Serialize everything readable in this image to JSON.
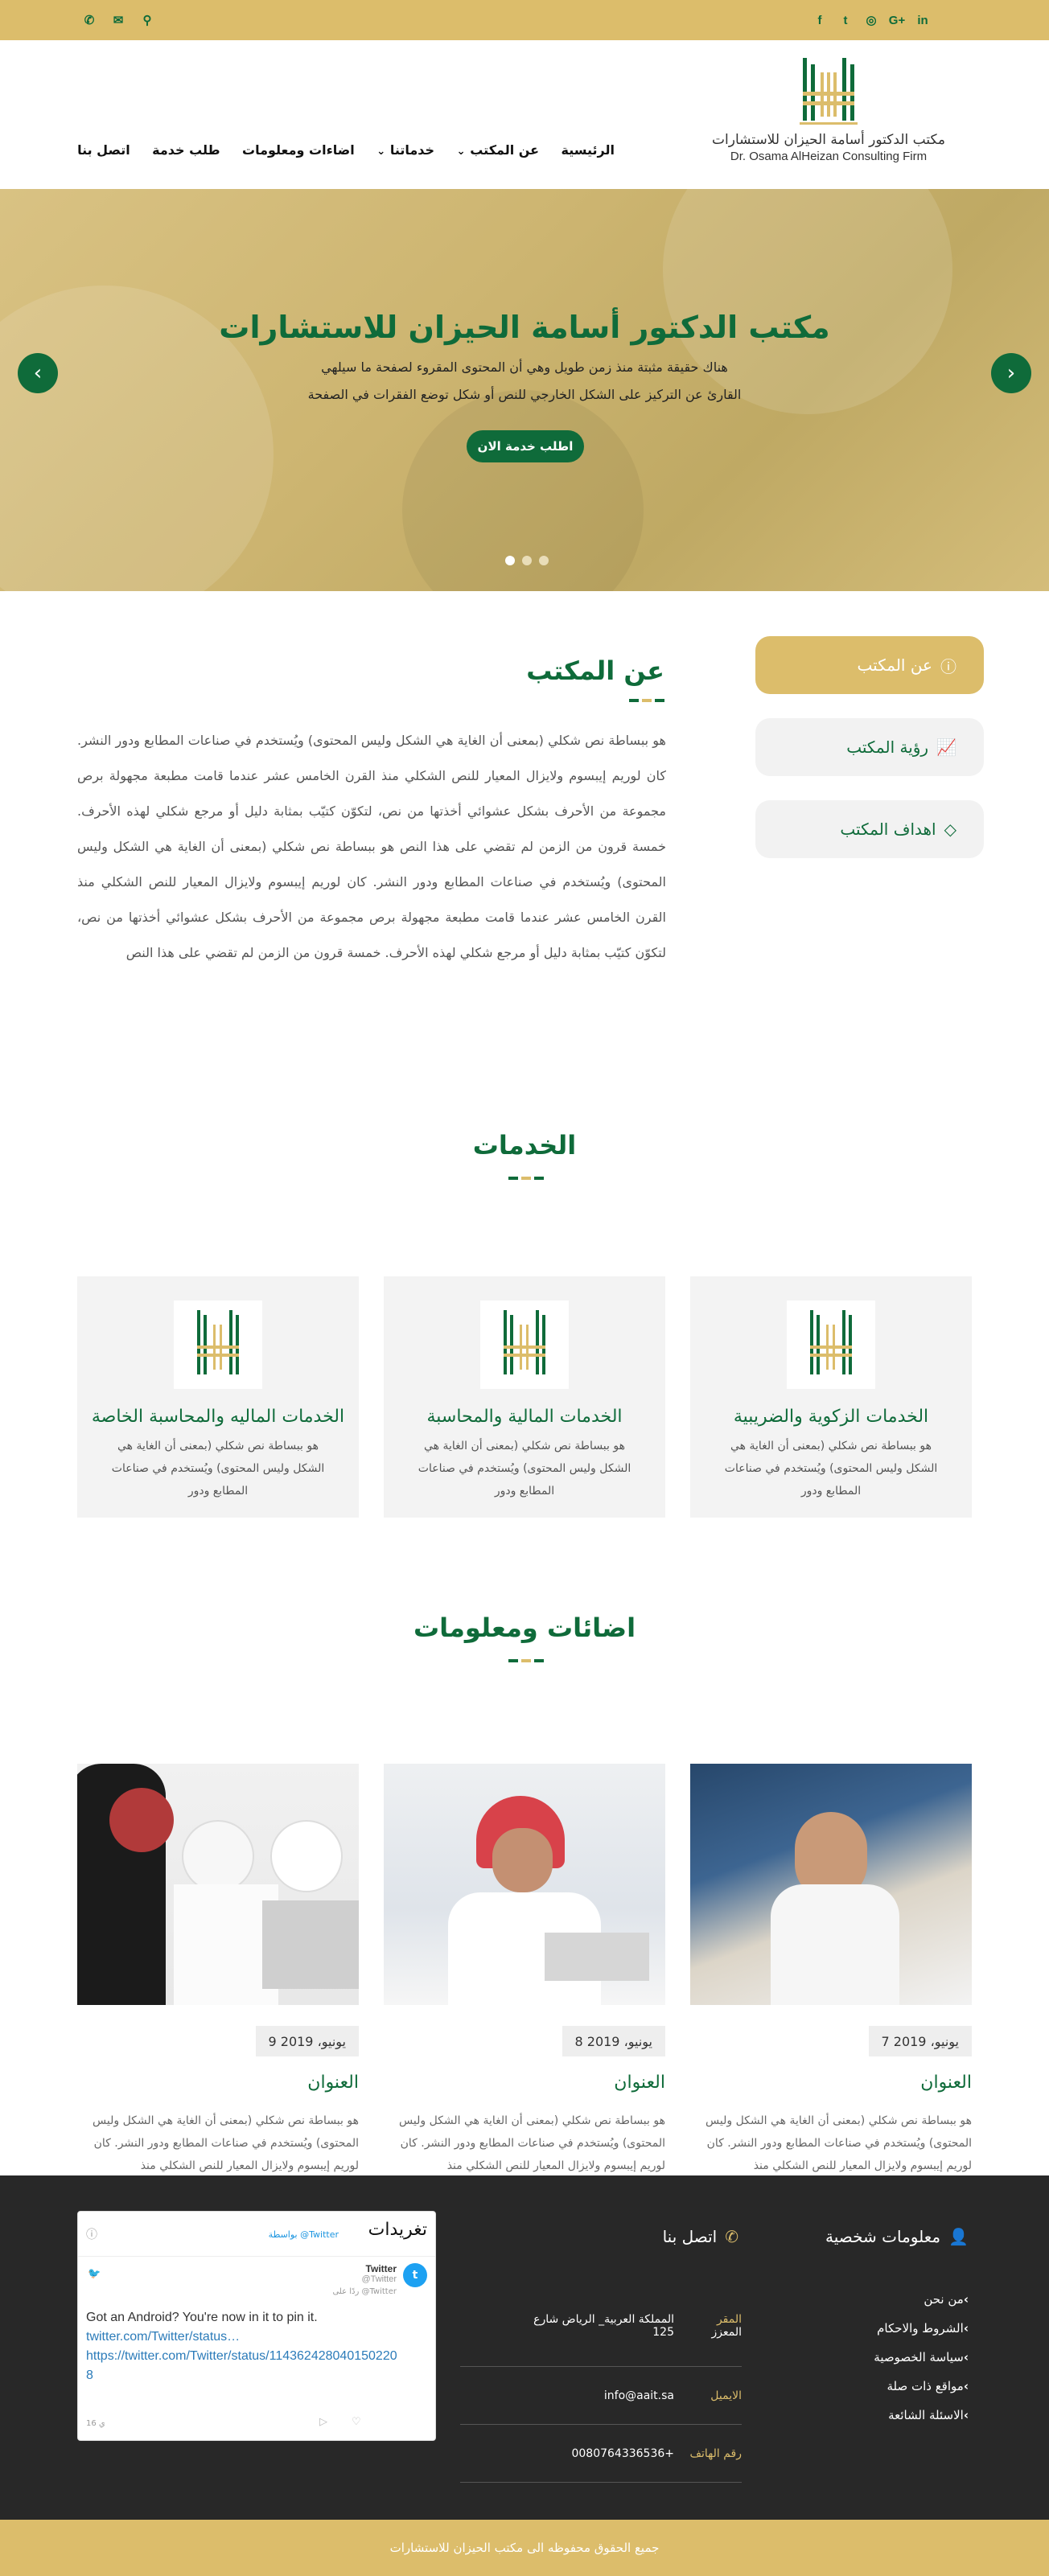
{
  "topbar": {
    "social_icons": [
      "facebook-icon",
      "twitter-icon",
      "instagram-icon",
      "google-plus-icon",
      "linkedin-icon"
    ],
    "social_glyphs": [
      "f",
      "t",
      "◎",
      "G+",
      "in"
    ],
    "tool_icons": [
      "phone-icon",
      "envelope-icon",
      "search-icon"
    ],
    "tool_glyphs": [
      "✆",
      "✉",
      "⚲"
    ]
  },
  "logo": {
    "line1": "مكتب الدكتور أسامة الحيزان للاستشارات",
    "line2": "Dr. Osama AlHeizan Consulting Firm"
  },
  "nav": {
    "items": [
      "الرئيسية",
      "عن المكتب",
      "خدماتنا",
      "اضاءات ومعلومات",
      "طلب خدمة",
      "اتصل بنا"
    ]
  },
  "hero": {
    "title": "مكتب الدكتور أسامة الحيزان للاستشارات",
    "line1": "هناك حقيقة مثبتة منذ زمن طويل وهي أن المحتوى المقروء لصفحة ما سيلهي",
    "line2": "القارئ عن التركيز على الشكل الخارجي للنص أو شكل توضع الفقرات في الصفحة",
    "button": "اطلب خدمة الان",
    "prev": "‹",
    "next": "›"
  },
  "about": {
    "title": "عن المكتب",
    "text": "هو ببساطة نص شكلي (بمعنى أن الغاية هي الشكل وليس المحتوى) ويُستخدم في صناعات المطابع ودور النشر. كان لوريم إيبسوم ولايزال المعيار للنص الشكلي منذ القرن الخامس عشر عندما قامت مطبعة مجهولة برص مجموعة من الأحرف بشكل عشوائي أخذتها من نص، لتكوّن كتيّب بمثابة دليل أو مرجع شكلي لهذه الأحرف. خمسة قرون من الزمن لم تقضي على هذا النص هو ببساطة نص شكلي (بمعنى أن الغاية هي الشكل وليس المحتوى) ويُستخدم في صناعات المطابع ودور النشر. كان لوريم إيبسوم ولايزال المعيار للنص الشكلي منذ القرن الخامس عشر عندما قامت مطبعة مجهولة برص مجموعة من الأحرف بشكل عشوائي أخذتها من نص، لتكوّن كتيّب بمثابة دليل أو مرجع شكلي لهذه الأحرف. خمسة قرون من الزمن لم تقضي على هذا النص",
    "tabs": [
      "عن المكتب",
      "رؤية المكتب",
      "اهداف المكتب"
    ]
  },
  "services": {
    "title": "الخدمات",
    "cards": [
      {
        "title": "الخدمات الزكوية والضريبية",
        "text": "هو ببساطة نص شكلي (بمعنى أن الغاية هي الشكل وليس المحتوى) ويُستخدم في صناعات المطابع ودور"
      },
      {
        "title": "الخدمات المالية والمحاسبة",
        "text": "هو ببساطة نص شكلي (بمعنى أن الغاية هي الشكل وليس المحتوى) ويُستخدم في صناعات المطابع ودور"
      },
      {
        "title": "الخدمات الماليه والمحاسبة الخاصة",
        "text": "هو ببساطة نص شكلي (بمعنى أن الغاية هي الشكل وليس المحتوى) ويُستخدم في صناعات المطابع ودور"
      }
    ]
  },
  "news": {
    "title": "اضائات ومعلومات",
    "posts": [
      {
        "date": "7 يونيو، 2019",
        "title": "العنوان",
        "text": "هو ببساطة نص شكلي (بمعنى أن الغاية هي الشكل وليس المحتوى) ويُستخدم في صناعات المطابع ودور النشر. كان لوريم إيبسوم ولايزال المعيار للنص الشكلي منذ"
      },
      {
        "date": "8 يونيو، 2019",
        "title": "العنوان",
        "text": "هو ببساطة نص شكلي (بمعنى أن الغاية هي الشكل وليس المحتوى) ويُستخدم في صناعات المطابع ودور النشر. كان لوريم إيبسوم ولايزال المعيار للنص الشكلي منذ"
      },
      {
        "date": "9 يونيو، 2019",
        "title": "العنوان",
        "text": "هو ببساطة نص شكلي (بمعنى أن الغاية هي الشكل وليس المحتوى) ويُستخدم في صناعات المطابع ودور النشر. كان لوريم إيبسوم ولايزال المعيار للنص الشكلي منذ"
      }
    ]
  },
  "footer": {
    "personal_title": "معلومات شخصية",
    "links": [
      "من نحن",
      "الشروط والاحكام",
      "سياسة الخصوصية",
      "مواقع ذات صلة",
      "الاسئلة الشائعة"
    ],
    "contact_title": "اتصل بنا",
    "address_label": "المقر",
    "address_sub": "المعزز",
    "address_value": "المملكة العربية_ الرياض شارع",
    "address_num": "125",
    "email_label": "الايميل",
    "email_value": "info@aait.sa",
    "phone_label": "رقم الهاتف",
    "phone_value": "+0080764336536",
    "tweets_title": "تغريدات",
    "tweets_by": "بواسطة @Twitter",
    "tweet_user": "Twitter",
    "tweet_handle": "@Twitter",
    "tweet_rt": "ردًا على @Twitter",
    "tweet_text": "Got an Android? You're now in it to pin it.",
    "tweet_link1": "twitter.com/Twitter/status…",
    "tweet_link2": "https://twitter.com/Twitter/status/1143624280401502208",
    "tweet_time": "16 ي"
  },
  "copyright": "جميع الحقوق محفوظه الى مكتب الحيزان للاستشارات",
  "colors": {
    "gold": "#dcbd6b",
    "green": "#0f6b3a",
    "dark": "#282828"
  }
}
